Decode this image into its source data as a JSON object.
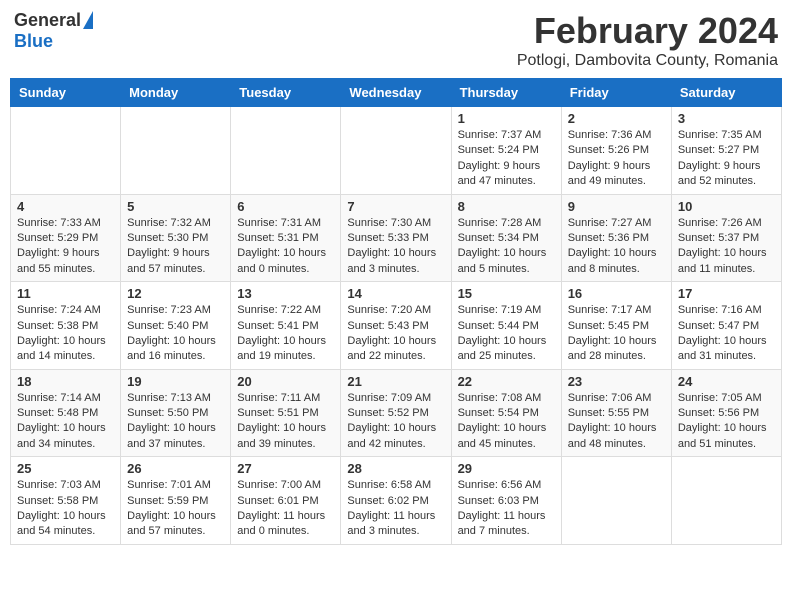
{
  "header": {
    "logo_general": "General",
    "logo_blue": "Blue",
    "month_title": "February 2024",
    "location": "Potlogi, Dambovita County, Romania"
  },
  "calendar": {
    "days_of_week": [
      "Sunday",
      "Monday",
      "Tuesday",
      "Wednesday",
      "Thursday",
      "Friday",
      "Saturday"
    ],
    "weeks": [
      [
        {
          "day": "",
          "info": ""
        },
        {
          "day": "",
          "info": ""
        },
        {
          "day": "",
          "info": ""
        },
        {
          "day": "",
          "info": ""
        },
        {
          "day": "1",
          "info": "Sunrise: 7:37 AM\nSunset: 5:24 PM\nDaylight: 9 hours\nand 47 minutes."
        },
        {
          "day": "2",
          "info": "Sunrise: 7:36 AM\nSunset: 5:26 PM\nDaylight: 9 hours\nand 49 minutes."
        },
        {
          "day": "3",
          "info": "Sunrise: 7:35 AM\nSunset: 5:27 PM\nDaylight: 9 hours\nand 52 minutes."
        }
      ],
      [
        {
          "day": "4",
          "info": "Sunrise: 7:33 AM\nSunset: 5:29 PM\nDaylight: 9 hours\nand 55 minutes."
        },
        {
          "day": "5",
          "info": "Sunrise: 7:32 AM\nSunset: 5:30 PM\nDaylight: 9 hours\nand 57 minutes."
        },
        {
          "day": "6",
          "info": "Sunrise: 7:31 AM\nSunset: 5:31 PM\nDaylight: 10 hours\nand 0 minutes."
        },
        {
          "day": "7",
          "info": "Sunrise: 7:30 AM\nSunset: 5:33 PM\nDaylight: 10 hours\nand 3 minutes."
        },
        {
          "day": "8",
          "info": "Sunrise: 7:28 AM\nSunset: 5:34 PM\nDaylight: 10 hours\nand 5 minutes."
        },
        {
          "day": "9",
          "info": "Sunrise: 7:27 AM\nSunset: 5:36 PM\nDaylight: 10 hours\nand 8 minutes."
        },
        {
          "day": "10",
          "info": "Sunrise: 7:26 AM\nSunset: 5:37 PM\nDaylight: 10 hours\nand 11 minutes."
        }
      ],
      [
        {
          "day": "11",
          "info": "Sunrise: 7:24 AM\nSunset: 5:38 PM\nDaylight: 10 hours\nand 14 minutes."
        },
        {
          "day": "12",
          "info": "Sunrise: 7:23 AM\nSunset: 5:40 PM\nDaylight: 10 hours\nand 16 minutes."
        },
        {
          "day": "13",
          "info": "Sunrise: 7:22 AM\nSunset: 5:41 PM\nDaylight: 10 hours\nand 19 minutes."
        },
        {
          "day": "14",
          "info": "Sunrise: 7:20 AM\nSunset: 5:43 PM\nDaylight: 10 hours\nand 22 minutes."
        },
        {
          "day": "15",
          "info": "Sunrise: 7:19 AM\nSunset: 5:44 PM\nDaylight: 10 hours\nand 25 minutes."
        },
        {
          "day": "16",
          "info": "Sunrise: 7:17 AM\nSunset: 5:45 PM\nDaylight: 10 hours\nand 28 minutes."
        },
        {
          "day": "17",
          "info": "Sunrise: 7:16 AM\nSunset: 5:47 PM\nDaylight: 10 hours\nand 31 minutes."
        }
      ],
      [
        {
          "day": "18",
          "info": "Sunrise: 7:14 AM\nSunset: 5:48 PM\nDaylight: 10 hours\nand 34 minutes."
        },
        {
          "day": "19",
          "info": "Sunrise: 7:13 AM\nSunset: 5:50 PM\nDaylight: 10 hours\nand 37 minutes."
        },
        {
          "day": "20",
          "info": "Sunrise: 7:11 AM\nSunset: 5:51 PM\nDaylight: 10 hours\nand 39 minutes."
        },
        {
          "day": "21",
          "info": "Sunrise: 7:09 AM\nSunset: 5:52 PM\nDaylight: 10 hours\nand 42 minutes."
        },
        {
          "day": "22",
          "info": "Sunrise: 7:08 AM\nSunset: 5:54 PM\nDaylight: 10 hours\nand 45 minutes."
        },
        {
          "day": "23",
          "info": "Sunrise: 7:06 AM\nSunset: 5:55 PM\nDaylight: 10 hours\nand 48 minutes."
        },
        {
          "day": "24",
          "info": "Sunrise: 7:05 AM\nSunset: 5:56 PM\nDaylight: 10 hours\nand 51 minutes."
        }
      ],
      [
        {
          "day": "25",
          "info": "Sunrise: 7:03 AM\nSunset: 5:58 PM\nDaylight: 10 hours\nand 54 minutes."
        },
        {
          "day": "26",
          "info": "Sunrise: 7:01 AM\nSunset: 5:59 PM\nDaylight: 10 hours\nand 57 minutes."
        },
        {
          "day": "27",
          "info": "Sunrise: 7:00 AM\nSunset: 6:01 PM\nDaylight: 11 hours\nand 0 minutes."
        },
        {
          "day": "28",
          "info": "Sunrise: 6:58 AM\nSunset: 6:02 PM\nDaylight: 11 hours\nand 3 minutes."
        },
        {
          "day": "29",
          "info": "Sunrise: 6:56 AM\nSunset: 6:03 PM\nDaylight: 11 hours\nand 7 minutes."
        },
        {
          "day": "",
          "info": ""
        },
        {
          "day": "",
          "info": ""
        }
      ]
    ]
  }
}
